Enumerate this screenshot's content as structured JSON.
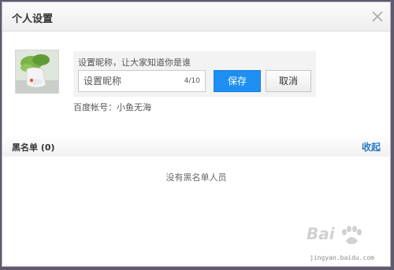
{
  "dialog": {
    "title": "个人设置",
    "close_icon": "close-icon"
  },
  "profile": {
    "nickname_hint": "设置昵称，让大家知道你是谁",
    "nickname_placeholder": "设置昵称",
    "nickname_value": "",
    "char_count": "4/10",
    "save_label": "保存",
    "cancel_label": "取消",
    "account_label": "百度帐号：",
    "account_value": "小鱼无海"
  },
  "blacklist": {
    "title": "黑名单 (0)",
    "collapse_label": "收起",
    "empty_message": "没有黑名单人员"
  },
  "watermark": {
    "logo": "baidu-jingyan-logo",
    "text": "jingyan.baidu.com"
  },
  "colors": {
    "accent": "#1e8ff2",
    "link": "#2a78c8"
  }
}
